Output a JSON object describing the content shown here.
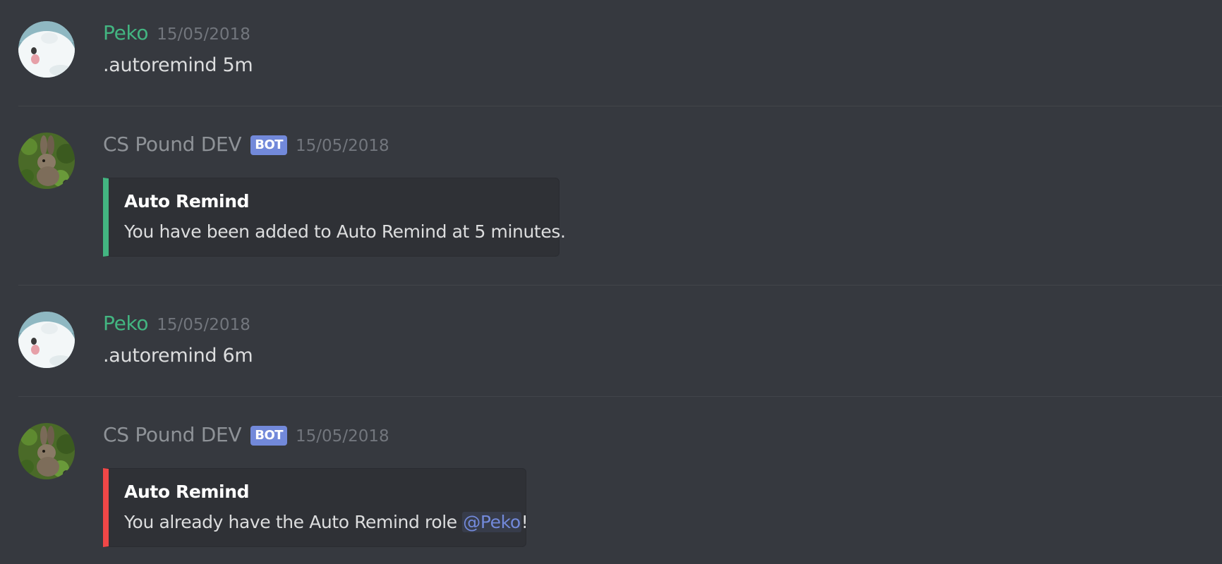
{
  "messages": [
    {
      "author": "Peko",
      "timestamp": "15/05/2018",
      "text": ".autoremind 5m"
    },
    {
      "author": "CS Pound DEV",
      "bot_tag": "BOT",
      "timestamp": "15/05/2018",
      "embed": {
        "title": "Auto Remind",
        "description": "You have been added to Auto Remind at 5 minutes.",
        "color": "#43b581"
      }
    },
    {
      "author": "Peko",
      "timestamp": "15/05/2018",
      "text": ".autoremind 6m"
    },
    {
      "author": "CS Pound DEV",
      "bot_tag": "BOT",
      "timestamp": "15/05/2018",
      "embed": {
        "title": "Auto Remind",
        "description_prefix": "You already have the Auto Remind role ",
        "mention": "@Peko",
        "description_suffix": "!",
        "color": "#f04747"
      }
    }
  ],
  "colors": {
    "background": "#36393f",
    "user_name": "#43b581",
    "bot_name": "#8e9297",
    "bot_tag": "#7289da",
    "embed_background": "#2f3136"
  },
  "icons": {
    "peko_avatar": "peko-avatar-icon",
    "bot_avatar": "rabbit-avatar-icon"
  }
}
